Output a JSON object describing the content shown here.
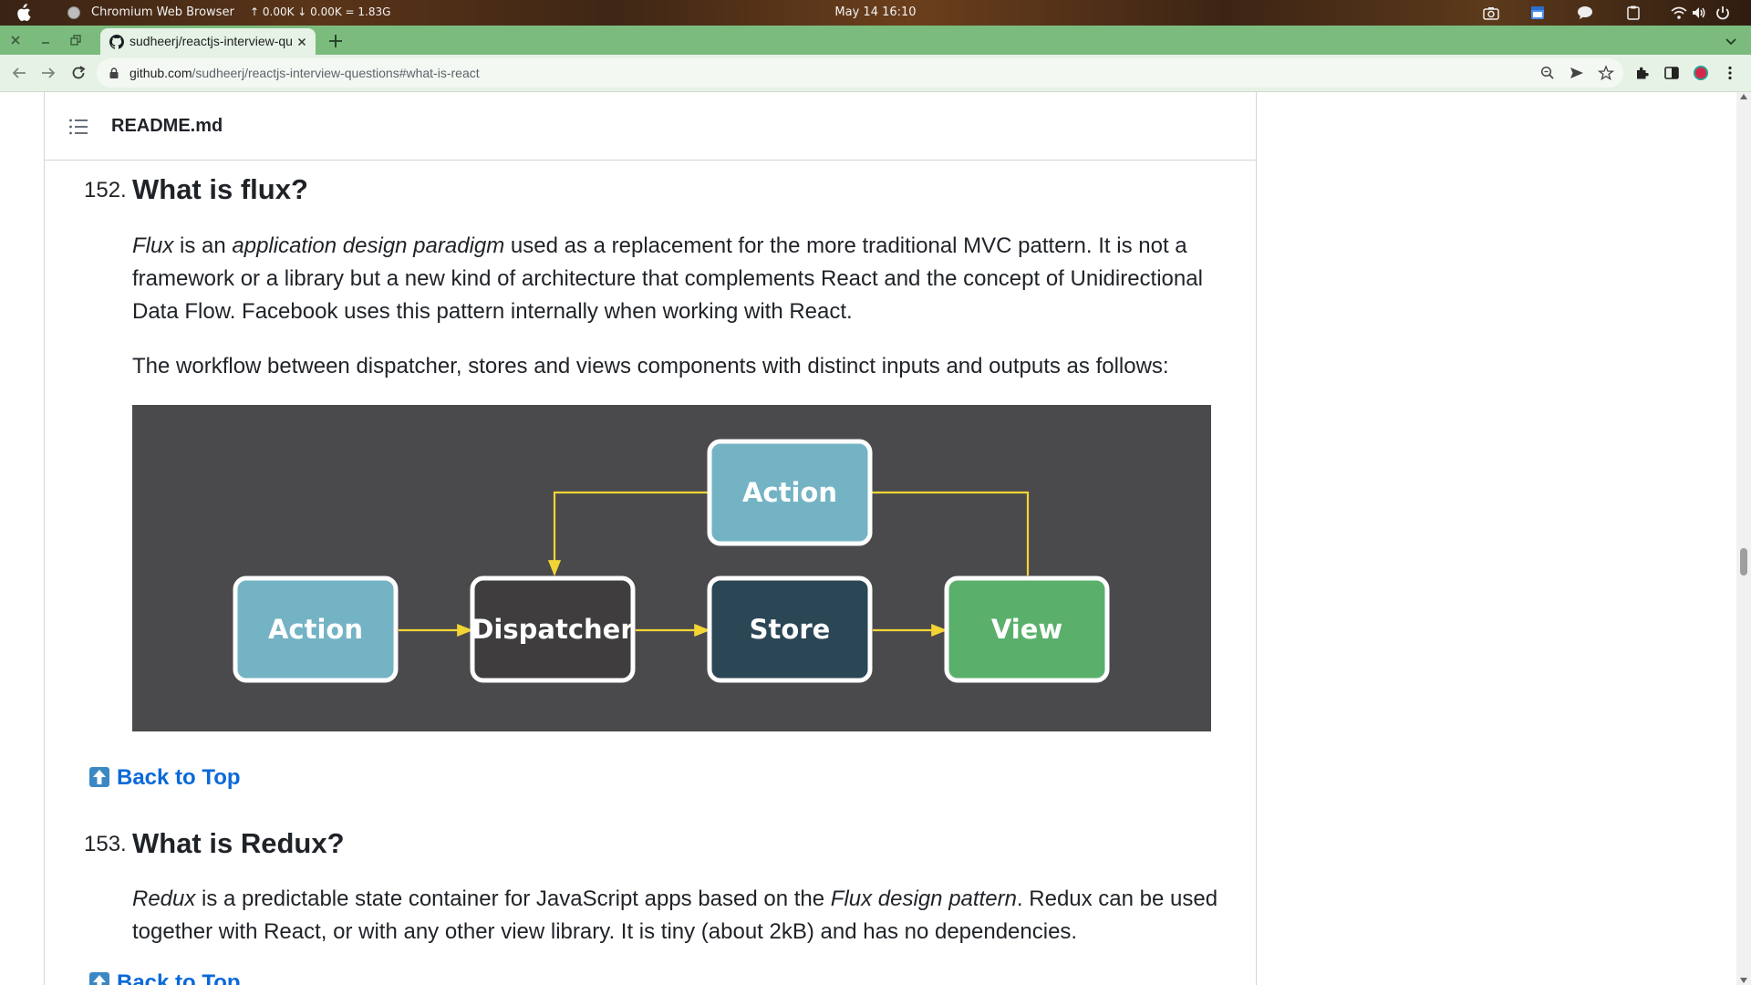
{
  "os_bar": {
    "app_name": "Chromium Web Browser",
    "net_stats": "↑ 0.00K ↓ 0.00K = 1.83G",
    "clock": "May 14  16:10"
  },
  "browser": {
    "tab_title": "sudheerj/reactjs-interview-questions",
    "url_domain": "github.com",
    "url_path": "/sudheerj/reactjs-interview-questions#what-is-react",
    "accent_color": "#7bbc7e"
  },
  "readme": {
    "filename": "README.md",
    "questions": [
      {
        "number": "152.",
        "title": "What is flux?",
        "p1_em1": "Flux",
        "p1_t1": " is an ",
        "p1_em2": "application design paradigm",
        "p1_t2": " used as a replacement for the more traditional MVC pattern. It is not a framework or a library but a new kind of architecture that complements React and the concept of Unidirectional Data Flow. Facebook uses this pattern internally when working with React.",
        "p2": "The workflow between dispatcher, stores and views components with distinct inputs and outputs as follows:"
      },
      {
        "number": "153.",
        "title": "What is Redux?",
        "p1_em1": "Redux",
        "p1_t1": " is a predictable state container for JavaScript apps based on the ",
        "p1_em2": "Flux design pattern",
        "p1_t2": ". Redux can be used together with React, or with any other view library. It is tiny (about 2kB) and has no dependencies."
      }
    ],
    "back_to_top": "Back to Top"
  },
  "diagram": {
    "nodes": {
      "action_top": {
        "label": "Action",
        "color": "#73b3c4"
      },
      "action": {
        "label": "Action",
        "color": "#73b3c4"
      },
      "dispatcher": {
        "label": "Dispatcher",
        "color": "#3f3d3e"
      },
      "store": {
        "label": "Store",
        "color": "#2b4655"
      },
      "view": {
        "label": "View",
        "color": "#5ab06b"
      }
    },
    "arrow_color": "#f2d535"
  }
}
